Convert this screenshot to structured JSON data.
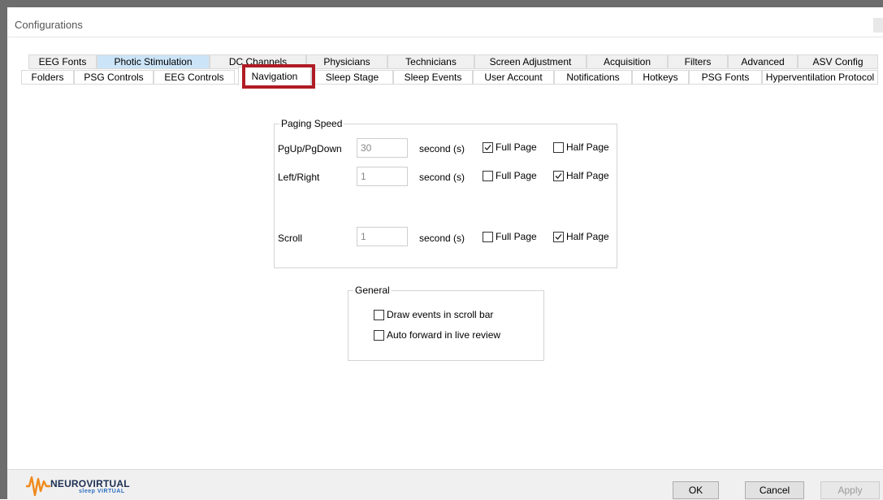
{
  "window": {
    "title": "Configurations"
  },
  "tabs_row_back": [
    {
      "label": "EEG Fonts"
    },
    {
      "label": "Photic Stimulation"
    },
    {
      "label": "DC Channels"
    },
    {
      "label": "Physicians"
    },
    {
      "label": "Technicians"
    },
    {
      "label": "Screen Adjustment"
    },
    {
      "label": "Acquisition"
    },
    {
      "label": "Filters"
    },
    {
      "label": "Advanced"
    },
    {
      "label": "ASV Config"
    }
  ],
  "tabs_row_front": [
    {
      "label": "Folders"
    },
    {
      "label": "PSG Controls"
    },
    {
      "label": "EEG Controls"
    },
    {
      "label": "Navigation"
    },
    {
      "label": "Sleep Stage"
    },
    {
      "label": "Sleep Events"
    },
    {
      "label": "User Account"
    },
    {
      "label": "Notifications"
    },
    {
      "label": "Hotkeys"
    },
    {
      "label": "PSG Fonts"
    },
    {
      "label": "Hyperventilation Protocol"
    }
  ],
  "active_tab": "Navigation",
  "highlight_color": "#b01c25",
  "paging_speed": {
    "legend": "Paging Speed",
    "rows": [
      {
        "label": "PgUp/PgDown",
        "value": "30",
        "unit": "second (s)",
        "full_page": "Full Page",
        "full_checked": true,
        "half_page": "Half Page",
        "half_checked": false
      },
      {
        "label": "Left/Right",
        "value": "1",
        "unit": "second (s)",
        "full_page": "Full Page",
        "full_checked": false,
        "half_page": "Half Page",
        "half_checked": true
      },
      {
        "label": "Scroll",
        "value": "1",
        "unit": "second (s)",
        "full_page": "Full Page",
        "full_checked": false,
        "half_page": "Half Page",
        "half_checked": true
      }
    ]
  },
  "general": {
    "legend": "General",
    "options": [
      {
        "label": "Draw events in scroll bar",
        "checked": false
      },
      {
        "label": "Auto forward in live review",
        "checked": false
      }
    ]
  },
  "footer": {
    "logo_text": "NEUROVIRTUAL",
    "logo_subtext": "sleep VIRTUAL",
    "ok": "OK",
    "cancel": "Cancel",
    "apply": "Apply"
  }
}
